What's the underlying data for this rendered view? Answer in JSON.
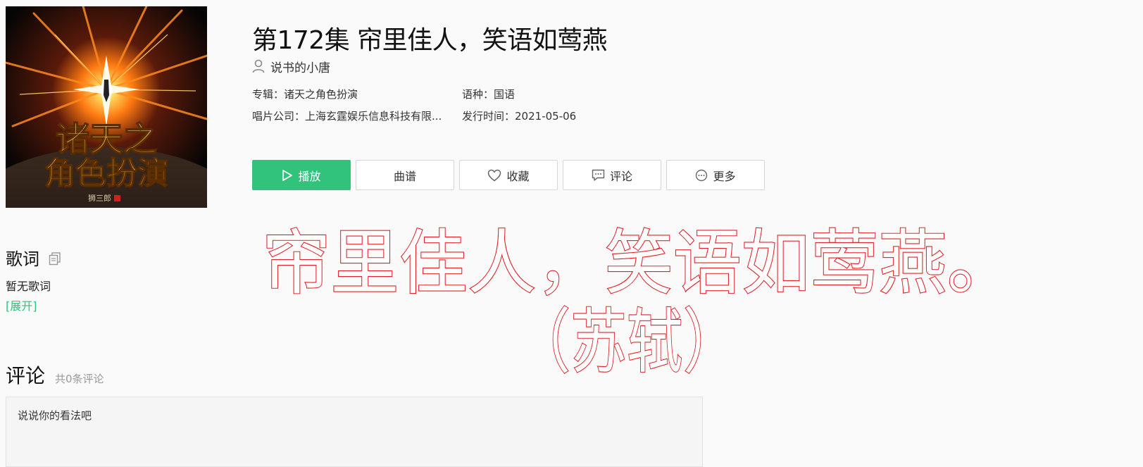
{
  "cover": {
    "title_line1": "诸天之",
    "title_line2": "角色扮演",
    "author_mark": "狮三郎"
  },
  "song": {
    "title": "第172集 帘里佳人，笑语如莺燕",
    "artist": "说书的小唐"
  },
  "meta": {
    "album_label": "专辑：",
    "album": "诸天之角色扮演",
    "language_label": "语种：",
    "language": "国语",
    "label_label": "唱片公司：",
    "label": "上海玄霆娱乐信息科技有限...",
    "release_label": "发行时间：",
    "release": "2021-05-06"
  },
  "actions": {
    "play": "播放",
    "score": "曲谱",
    "favorite": "收藏",
    "comment": "评论",
    "more": "更多"
  },
  "lyrics": {
    "heading": "歌词",
    "empty": "暂无歌词",
    "expand": "[展开]"
  },
  "comments": {
    "heading": "评论",
    "count": "共0条评论",
    "placeholder": "说说你的看法吧"
  },
  "overlay": {
    "line1": "帘里佳人，笑语如莺燕。",
    "line2": "（苏轼）"
  },
  "colors": {
    "accent": "#31c27c",
    "overlay_text": "#e0242a"
  }
}
